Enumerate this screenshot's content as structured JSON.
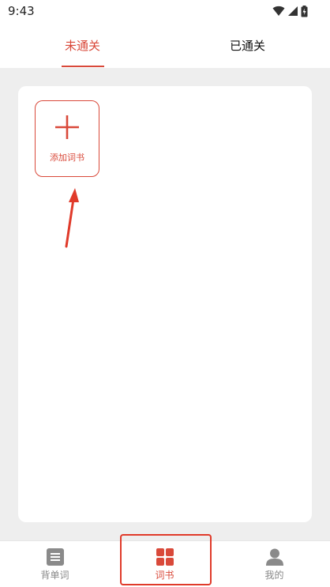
{
  "status_bar": {
    "time": "9:43",
    "icons": [
      "wifi-icon",
      "signal-icon",
      "battery-charging-icon"
    ]
  },
  "tabs": [
    {
      "label": "未通关",
      "active": true
    },
    {
      "label": "已通关",
      "active": false
    }
  ],
  "wordbook_grid": {
    "add_button": {
      "label": "添加词书",
      "icon": "plus-icon"
    }
  },
  "bottom_nav": [
    {
      "label": "背单词",
      "icon": "book-icon",
      "active": false
    },
    {
      "label": "词书",
      "icon": "grid-icon",
      "active": true
    },
    {
      "label": "我的",
      "icon": "person-icon",
      "active": false
    }
  ],
  "colors": {
    "accent": "#d9493a",
    "annotation": "#e03a2a",
    "background": "#eeeeee",
    "inactive": "#888888"
  }
}
